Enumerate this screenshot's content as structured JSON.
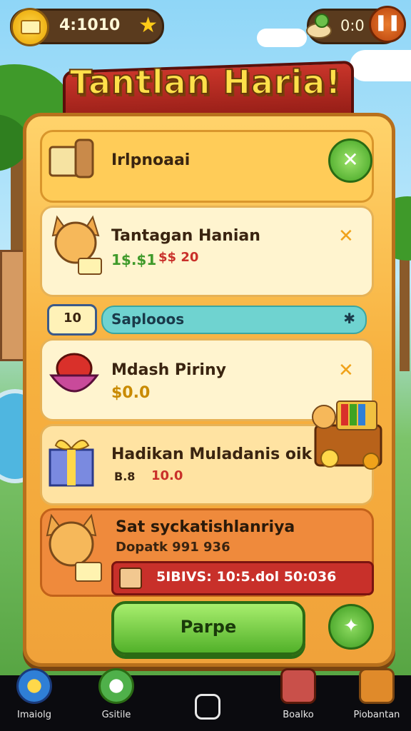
{
  "top_bar": {
    "coins": "4:1010",
    "timer": "0:0"
  },
  "title": "Tantlan Haria!",
  "header": {
    "label": "Irlpnoaai"
  },
  "tasks": [
    {
      "title": "Tantagan Hanian",
      "value_a": "1$.$1",
      "value_b": "$$ 20",
      "close": "✕"
    },
    {
      "title": "Mdash Piriny",
      "value_a": "$0.0",
      "value_b": "",
      "close": "✕"
    },
    {
      "title": "Hadikan Muladanis oik",
      "value_a": "B.8",
      "value_b": "10.0",
      "close": ""
    }
  ],
  "section": {
    "label": "Saplooos",
    "badge": "10",
    "mark": "✱"
  },
  "bonus": {
    "title": "Sat syckatishlanriya",
    "subtitle": "Dopatk 991 936",
    "bar_text": "5IBIVS: 10:5.dol 50:036"
  },
  "play_button": "Parpe",
  "nav": [
    {
      "label": "Imaiolg",
      "icon": "target-icon",
      "color": "#2f7fd6"
    },
    {
      "label": "Gsitile",
      "icon": "gauge-icon",
      "color": "#4fb04a"
    },
    {
      "label": "Boalko",
      "icon": "basket-icon",
      "color": "#c9504a"
    },
    {
      "label": "Piobantan",
      "icon": "sword-icon",
      "color": "#e08a2a"
    }
  ],
  "colors": {
    "accent": "#ffe04a",
    "panel": "#f7b13f",
    "banner": "#c9352a",
    "play": "#52b12a"
  }
}
